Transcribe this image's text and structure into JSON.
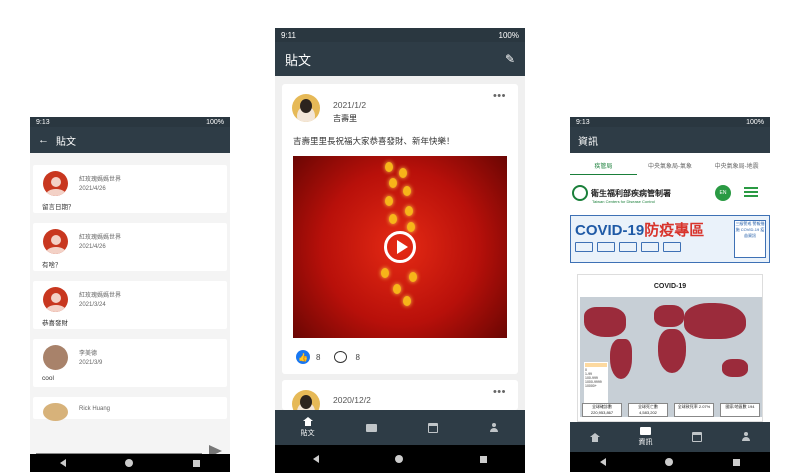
{
  "phone1": {
    "status_time": "9:13",
    "status_battery": "100%",
    "title": "貼文",
    "messages": [
      {
        "name": "紅玫瑰媽媽世界",
        "date": "2021/4/26",
        "text": "留言日期？"
      },
      {
        "name": "紅玫瑰媽媽世界",
        "date": "2021/4/26",
        "text": "有啥？"
      },
      {
        "name": "紅玫瑰媽媽世界",
        "date": "2021/3/24",
        "text": "恭喜發財"
      },
      {
        "name": "李美德",
        "date": "2021/3/9",
        "text": "cool"
      },
      {
        "name": "Rick Huang",
        "date": "",
        "text": ""
      }
    ]
  },
  "phone2": {
    "status_time": "9:11",
    "status_battery": "100%",
    "title": "貼文",
    "post": {
      "date": "2021/1/2",
      "author": "吉壽里",
      "body": "吉壽里里長祝福大家恭喜發財、新年快樂！",
      "likes": "8",
      "comments": "8"
    },
    "post2_date": "2020/12/2",
    "more": "•••",
    "nav": {
      "home_label": "貼文"
    }
  },
  "phone3": {
    "status_time": "9:13",
    "status_battery": "100%",
    "title": "資訊",
    "tabs": [
      "疾管局",
      "中央氣象局-氣象",
      "中央氣象局-地震"
    ],
    "cdc_name": "衛生福利部疾病管制署",
    "cdc_sub": "Taiwan Centers for Disease Control",
    "en_btn": "EN",
    "banner_title_a": "COVID-19",
    "banner_title_b": "防疫專區",
    "banner_box": "三級警戒 警報措施 COVID-19 疫苗資訊",
    "map_title": "COVID-19",
    "map_stats": [
      "全球確診數 220,953,867",
      "全球死亡數 4,583,202",
      "全球致死率 2.07%",
      "國家/地區數 194"
    ],
    "legend": [
      "0",
      "1-99",
      "100-999",
      "1000-9999",
      "10000+"
    ],
    "nav": {
      "info_label": "資訊"
    }
  }
}
